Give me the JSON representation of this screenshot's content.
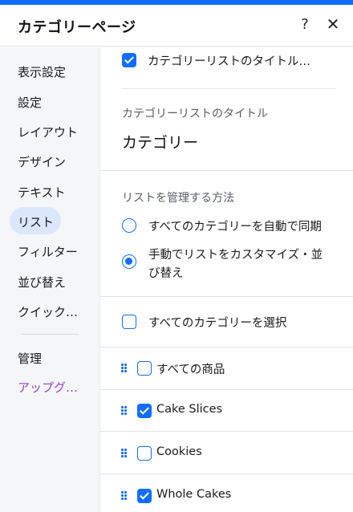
{
  "header": {
    "title": "カテゴリーページ",
    "help_icon": "?",
    "close_icon": "✕"
  },
  "sidebar": {
    "items": [
      {
        "label": "表示設定"
      },
      {
        "label": "設定"
      },
      {
        "label": "レイアウト"
      },
      {
        "label": "デザイン"
      },
      {
        "label": "テキスト"
      },
      {
        "label": "リスト",
        "active": true
      },
      {
        "label": "フィルター"
      },
      {
        "label": "並び替え"
      },
      {
        "label": "クイック…"
      },
      {
        "label": "管理"
      },
      {
        "label": "アップグ…"
      }
    ]
  },
  "main": {
    "show_title_checkbox": {
      "label": "カテゴリーリストのタイトル…",
      "checked": true
    },
    "title_section": {
      "label": "カテゴリーリストのタイトル",
      "value": "カテゴリー"
    },
    "manage_section": {
      "label": "リストを管理する方法",
      "options": [
        {
          "label": "すべてのカテゴリーを自動で同期",
          "selected": false
        },
        {
          "label_line1": "手動でリストをカスタマイズ・並",
          "label_line2": "び替え",
          "selected": true
        }
      ]
    },
    "select_all": {
      "label": "すべてのカテゴリーを選択",
      "checked": false
    },
    "categories": [
      {
        "label": "すべての商品",
        "checked": false
      },
      {
        "label": "Cake Slices",
        "checked": true
      },
      {
        "label": "Cookies",
        "checked": false
      },
      {
        "label": "Whole Cakes",
        "checked": true
      }
    ]
  },
  "colors": {
    "accent": "#116dff",
    "active_nav_bg": "#dbe7fd",
    "upgrade": "#9a3fcf"
  }
}
